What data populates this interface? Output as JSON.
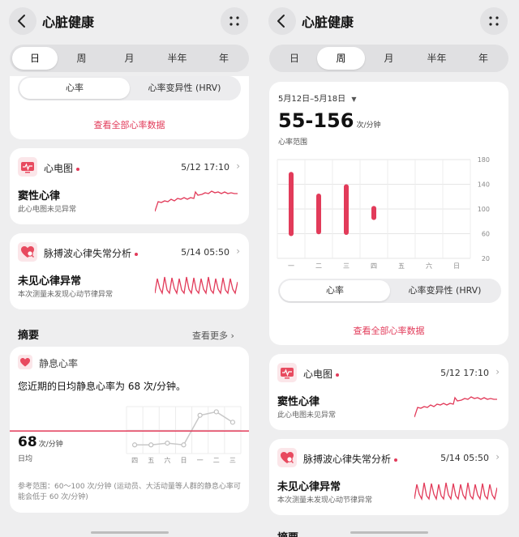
{
  "app": {
    "title": "心脏健康",
    "tabs": [
      "日",
      "周",
      "月",
      "半年",
      "年"
    ]
  },
  "colors": {
    "accent": "#e23b5a",
    "background": "#eeeeef",
    "card": "#ffffff"
  },
  "icons": [
    "back-arrow-icon",
    "more-dots-icon",
    "ecg-monitor-icon",
    "heart-search-icon",
    "heart-icon",
    "chevron-right-icon",
    "dropdown-triangle-icon"
  ],
  "left": {
    "active_tab": "日",
    "metric_toggle": {
      "options": [
        "心率",
        "心率变异性 (HRV)"
      ],
      "selected": "心率"
    },
    "view_all_link": "查看全部心率数据",
    "ecg": {
      "name": "心电图",
      "date": "5/12 17:10",
      "result": "窦性心律",
      "desc": "此心电图未见异常"
    },
    "ppg": {
      "name": "脉搏波心律失常分析",
      "date": "5/14 05:50",
      "result": "未见心律异常",
      "desc": "本次测量未发现心动节律异常"
    },
    "summary": {
      "title": "摘要",
      "more": "查看更多",
      "resting": {
        "name": "静息心率",
        "statement": "您近期的日均静息心率为 68 次/分钟。",
        "value": "68",
        "unit": "次/分钟",
        "label": "日均",
        "note": "参考范围：60～100 次/分钟 (运动员、大活动量等人群的静息心率可能会低于 60 次/分钟)"
      }
    }
  },
  "right": {
    "active_tab": "周",
    "date_range": "5月12日–5月18日",
    "range_value": "55-156",
    "range_unit": "次/分钟",
    "range_label": "心率范围",
    "metric_toggle": {
      "options": [
        "心率",
        "心率变异性 (HRV)"
      ],
      "selected": "心率"
    },
    "view_all_link": "查看全部心率数据",
    "ecg": {
      "name": "心电图",
      "date": "5/12 17:10",
      "result": "窦性心律",
      "desc": "此心电图未见异常"
    },
    "ppg": {
      "name": "脉搏波心律失常分析",
      "date": "5/14 05:50",
      "result": "未见心律异常",
      "desc": "本次测量未发现心动节律异常"
    },
    "summary_title": "摘要"
  },
  "chart_data": [
    {
      "type": "bar",
      "title": "",
      "categories": [
        "一",
        "二",
        "三",
        "四",
        "五",
        "六",
        "日"
      ],
      "series": [
        {
          "low": [
            60,
            63,
            62,
            86,
            null,
            null,
            null
          ],
          "high": [
            156,
            121,
            136,
            101,
            null,
            null,
            null
          ]
        }
      ],
      "ylim": [
        20,
        180
      ],
      "yticks": [
        20,
        60,
        100,
        140,
        180
      ],
      "grid": true
    },
    {
      "type": "line",
      "title": "",
      "categories": [
        "四",
        "五",
        "六",
        "日",
        "一",
        "二",
        "三"
      ],
      "values": [
        60,
        60,
        61,
        60,
        77,
        79,
        73
      ],
      "reference_line": 68,
      "grid": true
    }
  ]
}
